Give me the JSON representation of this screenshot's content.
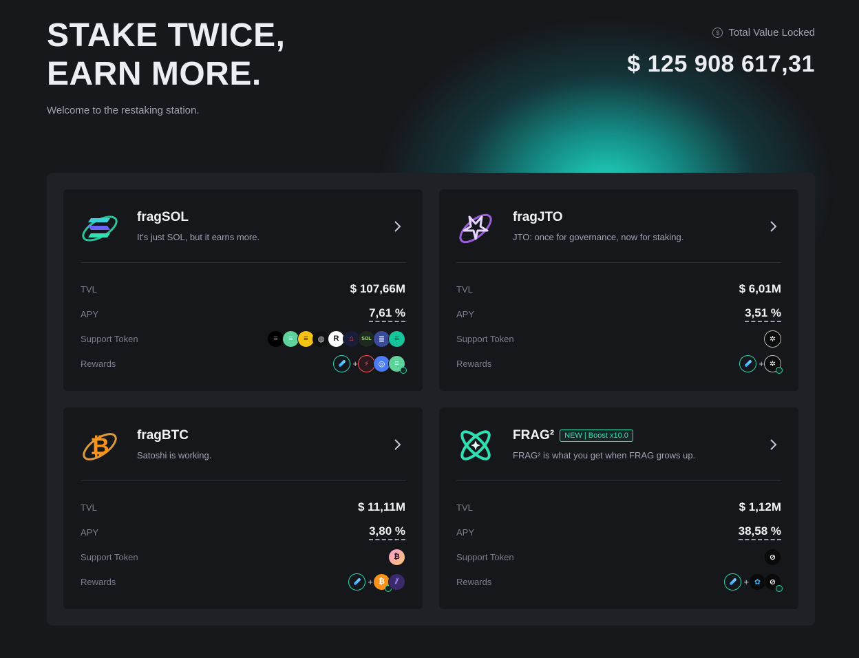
{
  "hero": {
    "title": "STAKE TWICE,\nEARN MORE.",
    "subtitle": "Welcome to the restaking station."
  },
  "tvl": {
    "label": "Total Value Locked",
    "value": "$ 125 908 617,31"
  },
  "row_labels": {
    "tvl": "TVL",
    "apy": "APY",
    "support": "Support Token",
    "rewards": "Rewards"
  },
  "cards": [
    {
      "name": "fragSOL",
      "description": "It's just SOL, but it earns more.",
      "tvl": "$ 107,66M",
      "apy": "7,61 %",
      "support_tokens": [
        "sol-token-icon",
        "jitosol-token-icon",
        "bsol-token-icon",
        "bnsol-token-icon",
        "rsol-token-icon",
        "hsol-token-icon",
        "solsol-token-icon",
        "stacked-sol-token-icon",
        "sol-green-token-icon"
      ],
      "rewards": [
        "frag-point-icon",
        "jupiter-token-icon",
        "switchboard-token-icon",
        "sol-green-token-icon"
      ]
    },
    {
      "name": "fragJTO",
      "description": "JTO: once for governance, now for staking.",
      "tvl": "$ 6,01M",
      "apy": "3,51 %",
      "support_tokens": [
        "jto-token-icon"
      ],
      "rewards": [
        "frag-point-icon",
        "jto-token-icon"
      ]
    },
    {
      "name": "fragBTC",
      "description": "Satoshi is working.",
      "tvl": "$ 11,11M",
      "apy": "3,80 %",
      "support_tokens": [
        "btc-token-icon"
      ],
      "rewards": [
        "frag-point-icon",
        "btc-token-icon",
        "solv-token-icon"
      ]
    },
    {
      "name": "FRAG²",
      "badge": "NEW | Boost x10.0",
      "description": "FRAG² is what you get when FRAG grows up.",
      "tvl": "$ 1,12M",
      "apy": "38,58 %",
      "support_tokens": [
        "frag-token-icon"
      ],
      "rewards": [
        "frag-point-icon",
        "paw-token-icon",
        "frag-token-icon"
      ]
    }
  ],
  "colors": {
    "background": "#17181c",
    "panel": "#1f2126",
    "card": "#16171b",
    "accent": "#2fe0b3",
    "glow": "#21e0c7"
  }
}
